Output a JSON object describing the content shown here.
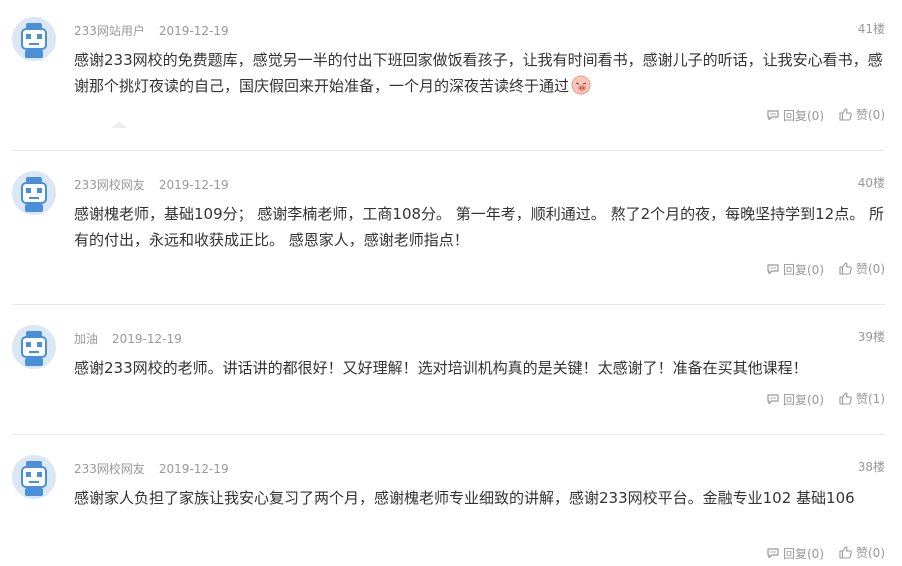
{
  "comments": [
    {
      "user": "233网站用户",
      "date": "2019-12-19",
      "floor": "41楼",
      "content": "感谢233网校的免费题库，感觉另一半的付出下班回家做饭看孩子，让我有时间看书，感谢儿子的听话，让我安心看书，感谢那个挑灯夜读的自己，国庆假回来开始准备，一个月的深夜苦读终于通过",
      "emoji": "piggy-emoji",
      "reply": "回复(0)",
      "like": "赞(0)"
    },
    {
      "user": "233网校网友",
      "date": "2019-12-19",
      "floor": "40楼",
      "content": "感谢槐老师，基础109分； 感谢李楠老师，工商108分。 第一年考，顺利通过。 熬了2个月的夜，每晚坚持学到12点。 所有的付出，永远和收获成正比。 感恩家人，感谢老师指点！",
      "reply": "回复(0)",
      "like": "赞(0)"
    },
    {
      "user": "加油",
      "date": "2019-12-19",
      "floor": "39楼",
      "content": "感谢233网校的老师。讲话讲的都很好！又好理解！选对培训机构真的是关键！太感谢了！准备在买其他课程！",
      "reply": "回复(0)",
      "like": "赞(1)"
    },
    {
      "user": "233网校网友",
      "date": "2019-12-19",
      "floor": "38楼",
      "content": "感谢家人负担了家族让我安心复习了两个月，感谢槐老师专业细致的讲解，感谢233网校平台。金融专业102 基础106",
      "reply": "回复(0)",
      "like": "赞(0)"
    }
  ],
  "colors": {
    "meta": "#999999",
    "text": "#333333",
    "divider": "#e8e8e8",
    "avatar_bg": "#dbe7f5",
    "robot_blue": "#4a90d9"
  },
  "icons": {
    "avatar": "robot-avatar-icon",
    "reply": "comment-bubble-icon",
    "like": "thumbs-up-icon"
  }
}
